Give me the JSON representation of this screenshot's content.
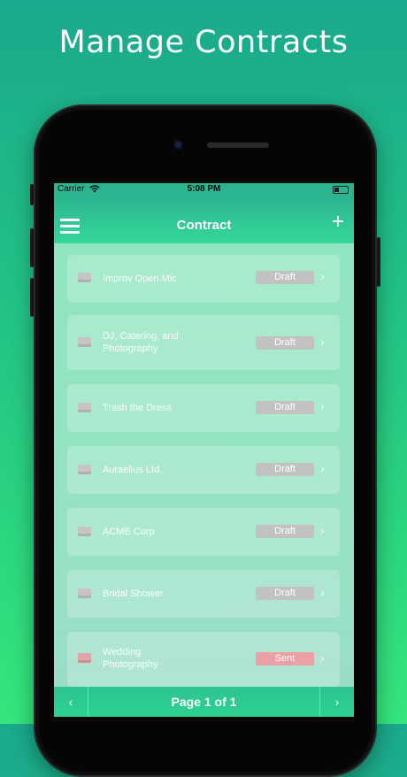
{
  "headline": "Manage Contracts",
  "status_bar": {
    "carrier": "Carrier",
    "time": "5:08 PM"
  },
  "nav": {
    "title": "Contract",
    "add_label": "+"
  },
  "contracts": [
    {
      "title": "Improv Open Mic",
      "status": "Draft",
      "status_color": "#c2c2c2"
    },
    {
      "title": "DJ, Catering, and Photography",
      "status": "Draft",
      "status_color": "#c2c2c2"
    },
    {
      "title": "Trash the Dress",
      "status": "Draft",
      "status_color": "#c2c2c2"
    },
    {
      "title": "Auraelius Ltd.",
      "status": "Draft",
      "status_color": "#c2c2c2"
    },
    {
      "title": "ACME Corp",
      "status": "Draft",
      "status_color": "#c2c2c2"
    },
    {
      "title": "Bridal Shower",
      "status": "Draft",
      "status_color": "#c2c2c2"
    },
    {
      "title": "Wedding Photography",
      "status": "Sent",
      "status_color": "#eba0a6"
    }
  ],
  "pager": {
    "label": "Page 1 of 1",
    "prev": "‹",
    "next": "›"
  },
  "icons": {
    "row_icon": "document-icon",
    "chevron": "chevron-right-icon"
  }
}
